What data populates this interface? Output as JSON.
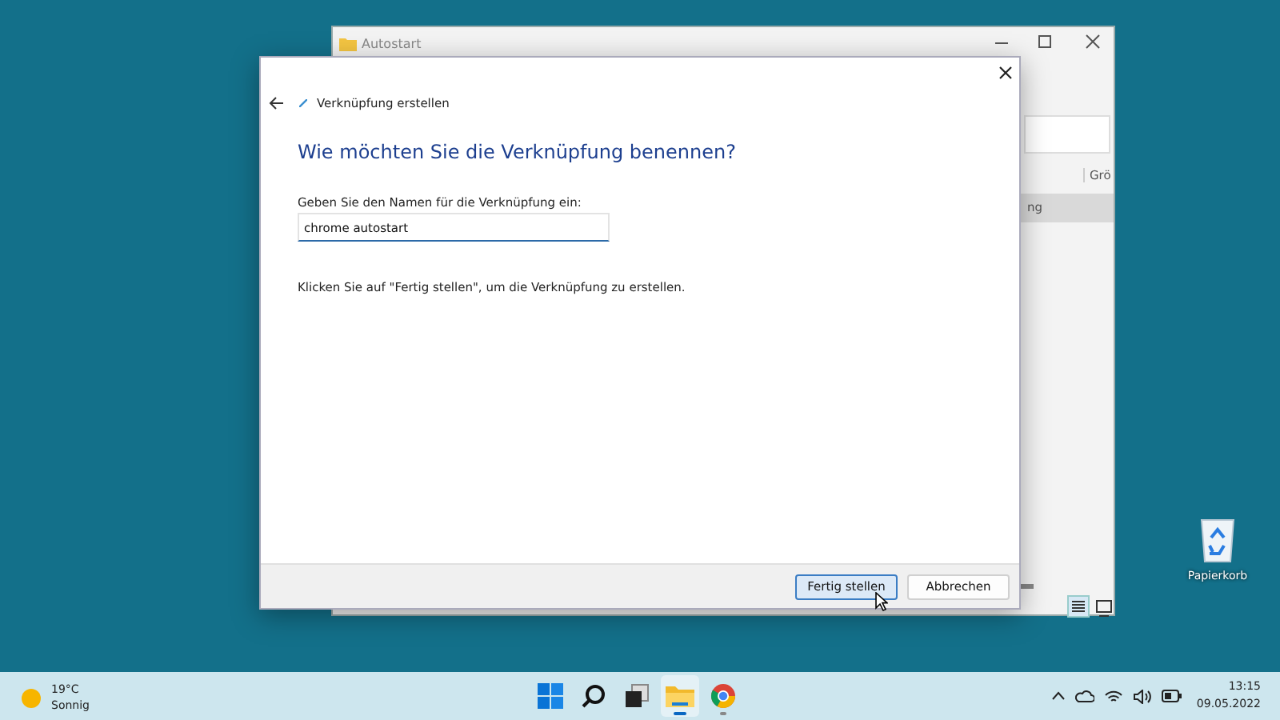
{
  "desktop": {
    "icons": [
      {
        "label": "Papierkorb"
      }
    ]
  },
  "explorer": {
    "title": "Autostart",
    "column_header": "Grö",
    "selected_row": "ng"
  },
  "dialog": {
    "title": "Verknüpfung erstellen",
    "heading": "Wie möchten Sie die Verknüpfung benennen?",
    "field_label": "Geben Sie den Namen für die Verknüpfung ein:",
    "field_value": "chrome autostart",
    "instruction": "Klicken Sie auf \"Fertig stellen\", um die Verknüpfung zu erstellen.",
    "buttons": [
      {
        "label": "Fertig stellen",
        "selected": true
      },
      {
        "label": "Abbrechen",
        "selected": false
      }
    ]
  },
  "taskbar": {
    "weather": {
      "temperature": "19°C",
      "condition": "Sonnig"
    },
    "apps": [
      {
        "kind": "start",
        "running": false,
        "active": false
      },
      {
        "kind": "search",
        "running": false,
        "active": false
      },
      {
        "kind": "taskview",
        "running": false,
        "active": false
      },
      {
        "kind": "explorer",
        "running": true,
        "active": true
      },
      {
        "kind": "chrome",
        "running": true,
        "active": false
      }
    ],
    "time": "13:15",
    "date": "09.05.2022"
  }
}
